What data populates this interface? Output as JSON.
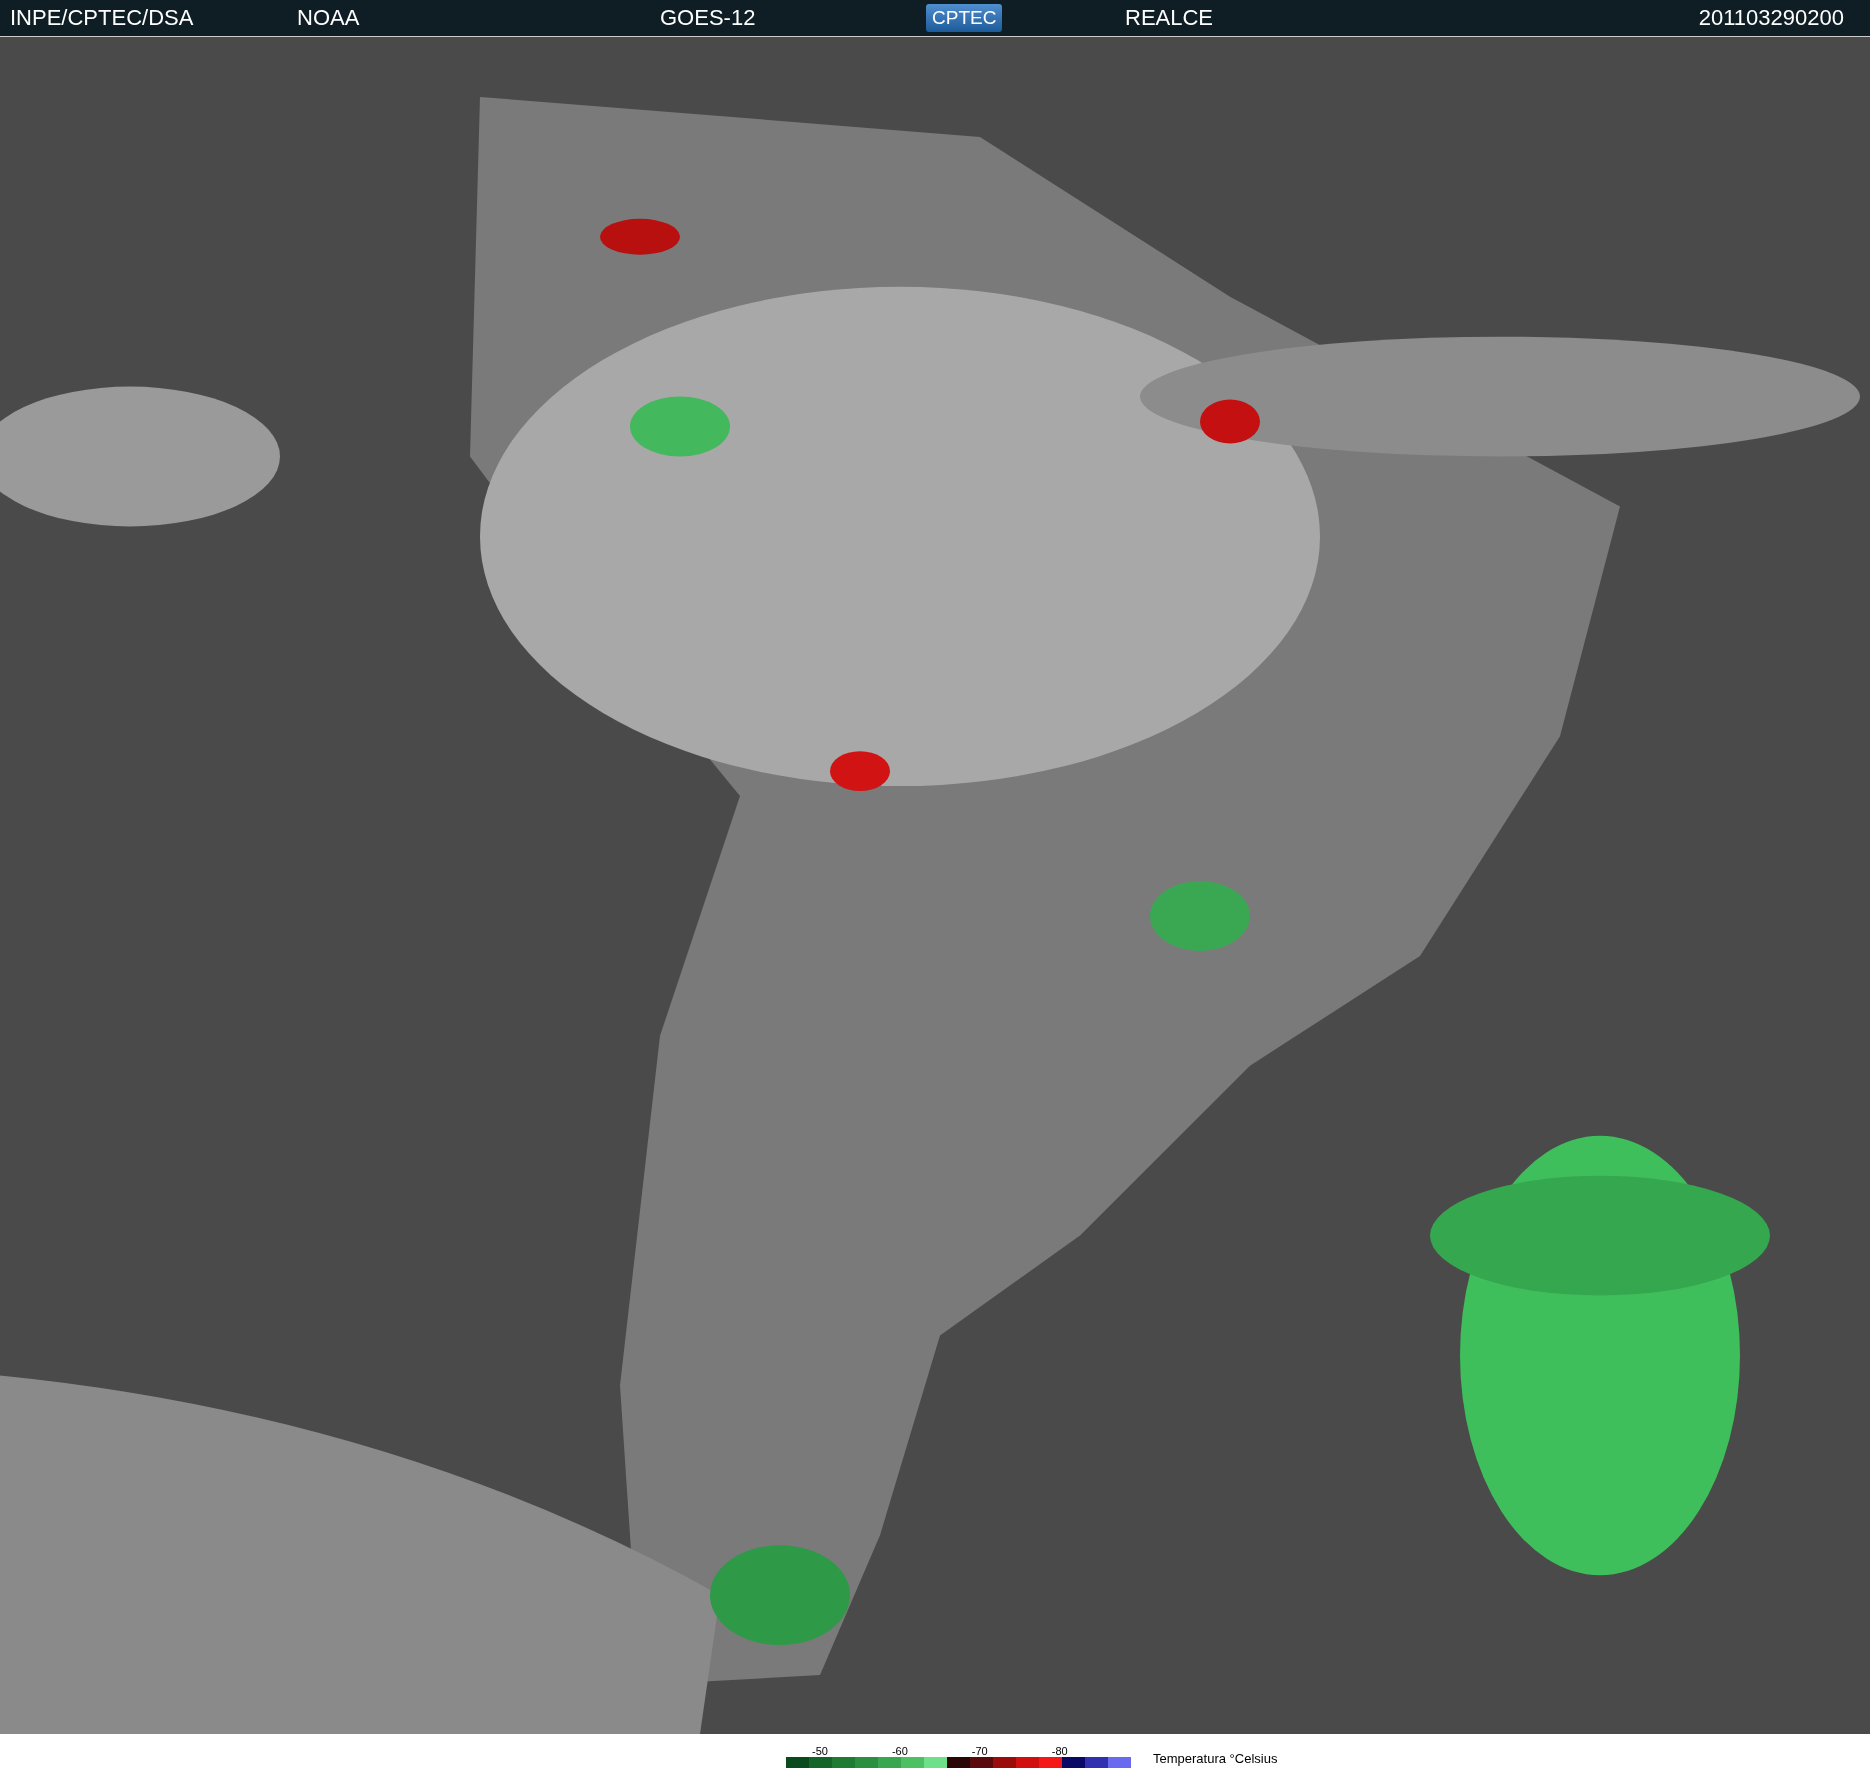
{
  "header": {
    "items": [
      "INPE/CPTEC/DSA",
      "NOAA",
      "GOES-12"
    ],
    "logo": "CPTEC",
    "channel": "REALCE",
    "timestamp": "201103290200"
  },
  "legend": {
    "ticks": [
      "-50",
      "-60",
      "-70",
      "-80"
    ],
    "title": "Temperatura °Celsius",
    "swatches": [
      {
        "color": "#0b4a1c"
      },
      {
        "color": "#166528"
      },
      {
        "color": "#1f7a33"
      },
      {
        "color": "#2a8f40"
      },
      {
        "color": "#39a650"
      },
      {
        "color": "#4cc062"
      },
      {
        "color": "#6ee08a"
      },
      {
        "color": "#2a0606"
      },
      {
        "color": "#5a0a0a"
      },
      {
        "color": "#9a0c0c"
      },
      {
        "color": "#d10f0f"
      },
      {
        "color": "#f41818"
      },
      {
        "color": "#0a0a66"
      },
      {
        "color": "#3030b0"
      },
      {
        "color": "#6a6af0"
      }
    ]
  }
}
